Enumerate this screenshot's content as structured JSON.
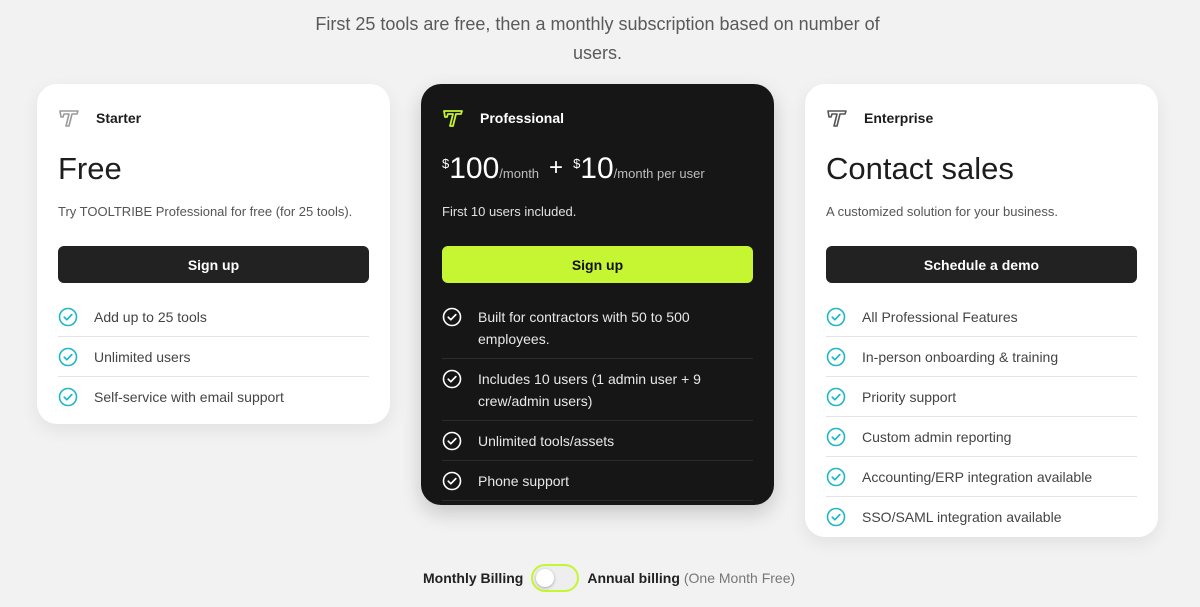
{
  "intro_text": "First 25 tools are free, then a monthly subscription based on number of users.",
  "colors": {
    "accent": "#c6f532",
    "check_teal": "#1fb6c9",
    "dark_card": "#161616"
  },
  "icons": {
    "plan_logo": "tooltribe-t-logo-icon",
    "feature_check": "check-circle-icon"
  },
  "plans": {
    "starter": {
      "name": "Starter",
      "price": "Free",
      "description": "Try TOOLTRIBE Professional for free (for 25 tools).",
      "cta": "Sign up",
      "features": [
        "Add up to 25 tools",
        "Unlimited users",
        "Self-service with email support"
      ]
    },
    "professional": {
      "name": "Professional",
      "currency": "$",
      "base_amount": "100",
      "base_period": "/month",
      "plus": "+",
      "user_amount": "10",
      "user_period": "/month per user",
      "description": "First 10 users included.",
      "cta": "Sign up",
      "features": [
        "Built for contractors with 50 to 500 employees.",
        "Includes 10 users (1 admin user + 9 crew/admin users)",
        "Unlimited tools/assets",
        "Phone support"
      ]
    },
    "enterprise": {
      "name": "Enterprise",
      "price": "Contact sales",
      "description": "A customized solution for your business.",
      "cta": "Schedule a demo",
      "features": [
        "All Professional Features",
        "In-person onboarding & training",
        "Priority support",
        "Custom admin reporting",
        "Accounting/ERP integration available",
        "SSO/SAML integration available"
      ]
    }
  },
  "billing": {
    "monthly_label": "Monthly Billing",
    "annual_label": "Annual billing",
    "annual_note": "(One Month Free)",
    "annual_selected": false
  }
}
